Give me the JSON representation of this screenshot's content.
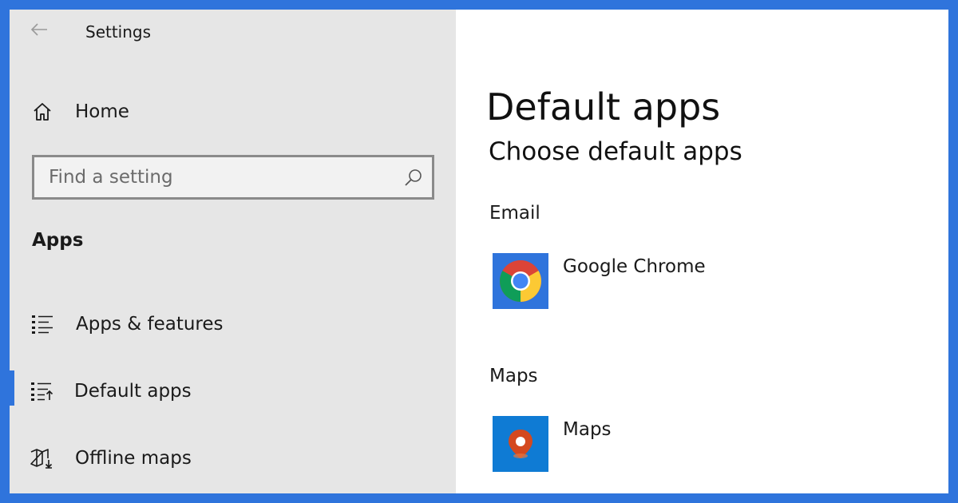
{
  "window": {
    "title": "Settings"
  },
  "sidebar": {
    "home_label": "Home",
    "search": {
      "placeholder": "Find a setting"
    },
    "section_header": "Apps",
    "items": [
      {
        "label": "Apps & features",
        "icon": "list-icon"
      },
      {
        "label": "Default apps",
        "icon": "default-apps-icon",
        "selected": true
      },
      {
        "label": "Offline maps",
        "icon": "offline-maps-icon"
      }
    ]
  },
  "main": {
    "title": "Default apps",
    "subtitle": "Choose default apps",
    "categories": [
      {
        "label": "Email",
        "app": "Google Chrome",
        "icon": "chrome-icon"
      },
      {
        "label": "Maps",
        "app": "Maps",
        "icon": "maps-icon"
      }
    ]
  },
  "colors": {
    "accent": "#2f74dc",
    "sidebar_bg": "#e6e6e6",
    "content_bg": "#ffffff",
    "app_tile_blue": "#2f74dc",
    "maps_tile_blue": "#0f7bd4"
  }
}
